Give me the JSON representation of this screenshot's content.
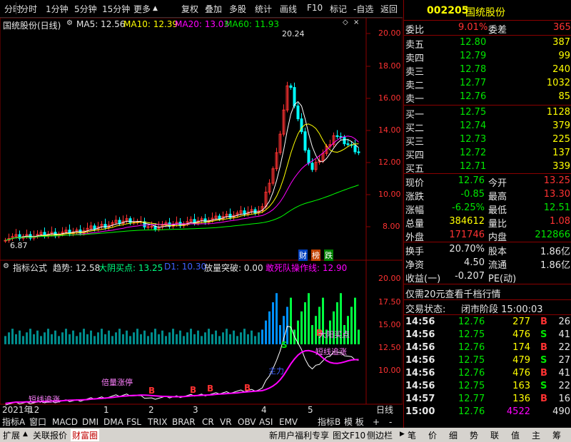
{
  "toolbar": {
    "left": [
      "分时",
      "1分钟",
      "5分钟",
      "15分钟",
      "更多"
    ],
    "right": [
      "复权",
      "叠加",
      "多股",
      "统计",
      "画线",
      "F10",
      "标记",
      "-自选",
      "返回"
    ]
  },
  "main_chart": {
    "title": "国统股份(日线)",
    "ma5": "MA5: 12.56",
    "ma10": "MA10: 12.39",
    "ma20": "MA20: 13.03",
    "ma60": "MA60: 11.93",
    "high_label": "20.24",
    "low_label": "6.87",
    "y_ticks": [
      "20.00",
      "18.00",
      "16.00",
      "14.00",
      "12.00",
      "10.00",
      "8.00"
    ],
    "badges": [
      "财",
      "榜",
      "跌"
    ],
    "colors": {
      "ma5": "#ffffff",
      "ma10": "#ffff00",
      "ma20": "#ff00ff",
      "ma60": "#00ff00",
      "up": "#ff3232",
      "down": "#00ffff"
    }
  },
  "indicator": {
    "name": "指标公式",
    "trend": "趋势: 12.58",
    "yang": "大阴买点: 13.25",
    "d1": "D1: 10.30",
    "vol": "放量突破: 0.00",
    "team": "敢死队操作线: 12.90",
    "y_ticks": [
      "20.00",
      "17.50",
      "15.00",
      "12.50",
      "10.00"
    ],
    "annotations": [
      "倍量涨停",
      "短线追涨",
      "主力",
      "B",
      "B",
      "B",
      "B",
      "B",
      "S",
      "大阳买点",
      "短线追涨"
    ]
  },
  "date_axis": {
    "year": "2021年",
    "months": [
      "12",
      "1",
      "2",
      "3",
      "4",
      "5"
    ],
    "period": "日线"
  },
  "bottom_tabs": [
    "指标A",
    "窗口",
    "MACD",
    "DMI",
    "DMA",
    "FSL",
    "TRIX",
    "BRAR",
    "CR",
    "VR",
    "OBV",
    "ASI",
    "EMV",
    "指标B",
    "模 板",
    "+",
    "-"
  ],
  "bottom_tabs2": [
    "扩展",
    "关联报价",
    "财富圈"
  ],
  "status_right": [
    "新用户福利专享",
    "图文F10",
    "侧边栏"
  ],
  "quote": {
    "code": "002205",
    "name": "国统股份",
    "weibi_label": "委比",
    "weibi": "9.01%",
    "weicha_label": "委差",
    "weicha": "365",
    "sell": [
      {
        "label": "卖五",
        "price": "12.80",
        "vol": "387"
      },
      {
        "label": "卖四",
        "price": "12.79",
        "vol": "99"
      },
      {
        "label": "卖三",
        "price": "12.78",
        "vol": "240"
      },
      {
        "label": "卖二",
        "price": "12.77",
        "vol": "1032"
      },
      {
        "label": "卖一",
        "price": "12.76",
        "vol": "85"
      }
    ],
    "buy": [
      {
        "label": "买一",
        "price": "12.75",
        "vol": "1128"
      },
      {
        "label": "买二",
        "price": "12.74",
        "vol": "379"
      },
      {
        "label": "买三",
        "price": "12.73",
        "vol": "225"
      },
      {
        "label": "买四",
        "price": "12.72",
        "vol": "137"
      },
      {
        "label": "买五",
        "price": "12.71",
        "vol": "339"
      }
    ],
    "stats": [
      {
        "l1": "现价",
        "v1": "12.76",
        "l2": "今开",
        "v2": "13.25"
      },
      {
        "l1": "涨跌",
        "v1": "-0.85",
        "l2": "最高",
        "v2": "13.30"
      },
      {
        "l1": "涨幅",
        "v1": "-6.25%",
        "l2": "最低",
        "v2": "12.51"
      },
      {
        "l1": "总量",
        "v1": "384612",
        "l2": "量比",
        "v2": "1.08"
      },
      {
        "l1": "外盘",
        "v1": "171746",
        "l2": "内盘",
        "v2": "212866"
      }
    ],
    "stats2": [
      {
        "l1": "换手",
        "v1": "20.70%",
        "l2": "股本",
        "v2": "1.86亿"
      },
      {
        "l1": "净资",
        "v1": "4.50",
        "l2": "流通",
        "v2": "1.86亿"
      },
      {
        "l1": "收益(一)",
        "v1": "-0.207",
        "l2": "PE(动)",
        "v2": ""
      }
    ],
    "promo": "仅需20元查看千档行情",
    "status_label": "交易状态:",
    "status_value": "闭市阶段 15:00:03",
    "ticks": [
      {
        "t": "14:56",
        "p": "12.76",
        "v": "277",
        "d": "B",
        "n": "26"
      },
      {
        "t": "14:56",
        "p": "12.75",
        "v": "476",
        "d": "S",
        "n": "41"
      },
      {
        "t": "14:56",
        "p": "12.76",
        "v": "174",
        "d": "B",
        "n": "22"
      },
      {
        "t": "14:56",
        "p": "12.75",
        "v": "479",
        "d": "S",
        "n": "27"
      },
      {
        "t": "14:56",
        "p": "12.76",
        "v": "476",
        "d": "B",
        "n": "41"
      },
      {
        "t": "14:56",
        "p": "12.75",
        "v": "163",
        "d": "S",
        "n": "22"
      },
      {
        "t": "14:57",
        "p": "12.77",
        "v": "136",
        "d": "B",
        "n": "16"
      },
      {
        "t": "15:00",
        "p": "12.76",
        "v": "4522",
        "d": "",
        "n": "490"
      }
    ],
    "side_tabs": [
      "笔",
      "价",
      "细",
      "势",
      "联",
      "值",
      "主",
      "筹"
    ]
  }
}
